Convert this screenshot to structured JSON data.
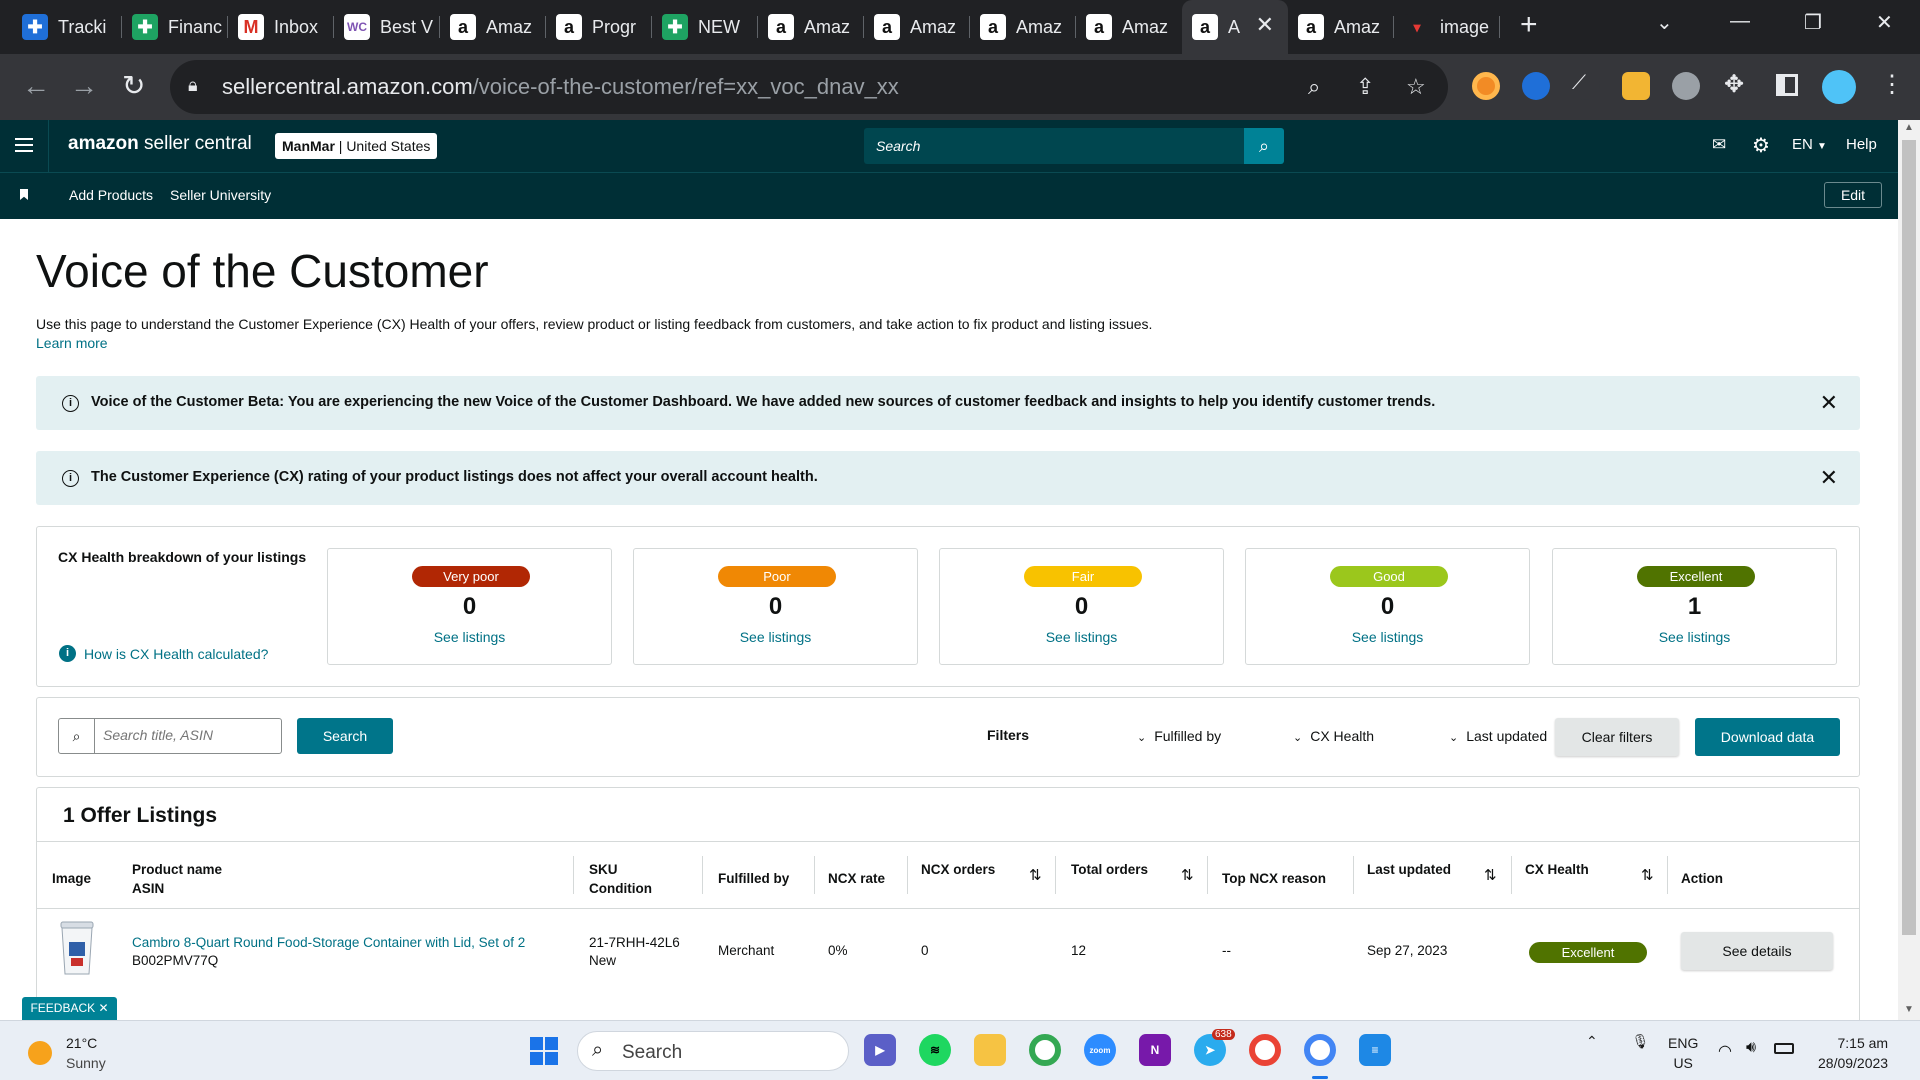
{
  "browser": {
    "tabs": [
      {
        "label": "Tracki",
        "icon": "clickup-icon"
      },
      {
        "label": "Financ",
        "icon": "sheets-icon"
      },
      {
        "label": "Inbox",
        "icon": "gmail-icon"
      },
      {
        "label": "Best V",
        "icon": "woocommerce-icon"
      },
      {
        "label": "Amaz",
        "icon": "amazon-icon"
      },
      {
        "label": "Progr",
        "icon": "amazon-icon"
      },
      {
        "label": "NEW",
        "icon": "sheets-icon"
      },
      {
        "label": "Amaz",
        "icon": "amazon-icon"
      },
      {
        "label": "Amaz",
        "icon": "amazon-icon"
      },
      {
        "label": "Amaz",
        "icon": "amazon-icon"
      },
      {
        "label": "Amaz",
        "icon": "amazon-icon"
      },
      {
        "label": "A",
        "icon": "amazon-icon"
      },
      {
        "label": "Amaz",
        "icon": "amazon-icon"
      },
      {
        "label": "image",
        "icon": "image-site-icon"
      }
    ],
    "url_domain": "sellercentral.amazon.com",
    "url_path": "/voice-of-the-customer/ref=xx_voc_dnav_xx"
  },
  "header": {
    "logo_bold": "amazon",
    "logo_rest": " seller central",
    "account_name": "ManMar",
    "account_region": " | United States",
    "search_placeholder": "Search",
    "language": "EN",
    "help": "Help",
    "bookmarks": [
      "Add Products",
      "Seller University"
    ],
    "edit": "Edit"
  },
  "page": {
    "title": "Voice of the Customer",
    "description": "Use this page to understand the Customer Experience (CX) Health of your offers, review product or listing feedback from customers, and take action to fix product and listing issues.",
    "learn_more": "Learn more",
    "banner_beta": "Voice of the Customer Beta: You are experiencing the new Voice of the Customer Dashboard. We have added new sources of customer feedback and insights to help you identify customer trends.",
    "banner_rating": "The Customer Experience (CX) rating of your product listings does not affect your overall account health."
  },
  "cx_health": {
    "title": "CX Health breakdown of your listings",
    "how_link": "How is CX Health calculated?",
    "see_listings": "See listings",
    "categories": [
      {
        "label": "Very poor",
        "count": "0",
        "color": "#b12704"
      },
      {
        "label": "Poor",
        "count": "0",
        "color": "#f08804"
      },
      {
        "label": "Fair",
        "count": "0",
        "color": "#f8c200"
      },
      {
        "label": "Good",
        "count": "0",
        "color": "#9bc71c"
      },
      {
        "label": "Excellent",
        "count": "1",
        "color": "#507300"
      }
    ]
  },
  "filters": {
    "search_placeholder": "Search title, ASIN",
    "search_button": "Search",
    "filters_label": "Filters",
    "dropdowns": [
      "Fulfilled by",
      "CX Health",
      "Last updated"
    ],
    "clear": "Clear filters",
    "download": "Download data"
  },
  "listings": {
    "heading": "1 Offer Listings",
    "columns": {
      "image": "Image",
      "product_name": "Product name",
      "asin": "ASIN",
      "sku": "SKU",
      "condition": "Condition",
      "fulfilled_by": "Fulfilled by",
      "ncx_rate": "NCX rate",
      "ncx_orders": "NCX orders",
      "total_orders": "Total orders",
      "top_ncx_reason": "Top NCX reason",
      "last_updated": "Last updated",
      "cx_health": "CX Health",
      "action": "Action"
    },
    "rows": [
      {
        "product_name": "Cambro 8-Quart Round Food-Storage Container with Lid, Set of 2",
        "asin": "B002PMV77Q",
        "sku": "21-7RHH-42L6",
        "condition": "New",
        "fulfilled_by": "Merchant",
        "ncx_rate": "0%",
        "ncx_orders": "0",
        "total_orders": "12",
        "top_ncx_reason": "--",
        "last_updated": "Sep 27, 2023",
        "cx_health": "Excellent",
        "action": "See details"
      }
    ]
  },
  "feedback_tab": "FEEDBACK ✕",
  "taskbar": {
    "weather_temp": "21°C",
    "weather_desc": "Sunny",
    "search": "Search",
    "badge": "638",
    "lang_1": "ENG",
    "lang_2": "US",
    "time": "7:15 am",
    "date": "28/09/2023"
  }
}
